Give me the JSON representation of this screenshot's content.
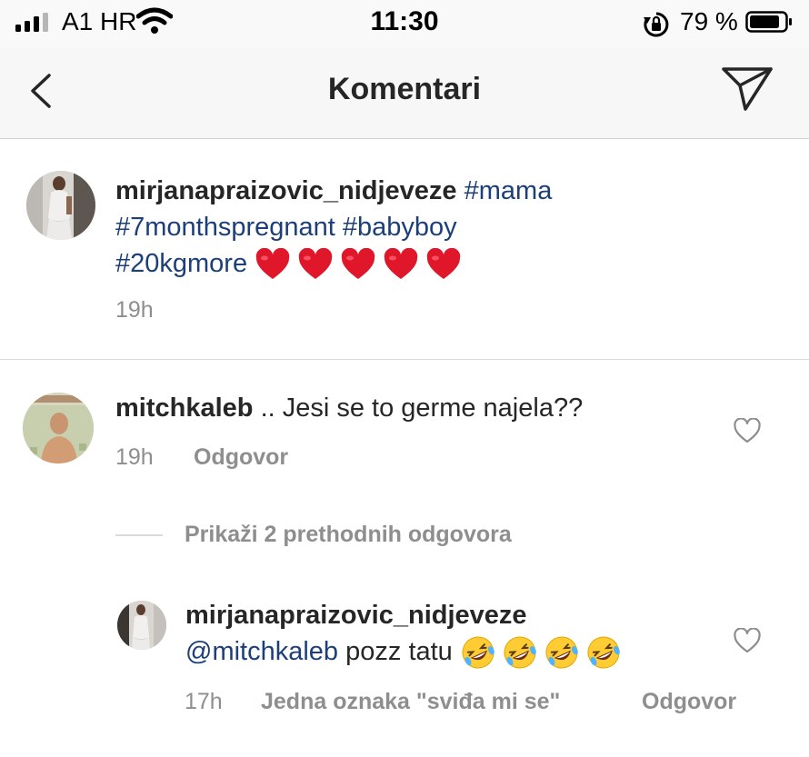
{
  "status_bar": {
    "carrier": "A1 HR",
    "time": "11:30",
    "battery_percent": "79 %",
    "signal_bars_filled": 3
  },
  "header": {
    "title": "Komentari",
    "back_icon": "chevron-left-icon",
    "send_icon": "paper-plane-icon"
  },
  "caption": {
    "username": "mirjanapraizovic_nidjeveze",
    "hashtags": [
      "#mama",
      "#7monthspregnant",
      "#babyboy",
      "#20kgmore"
    ],
    "emoji": "red-heart-emoji",
    "emoji_count": 5,
    "time": "19h"
  },
  "comment": {
    "username": "mitchkaleb",
    "text": ".. Jesi se to germe najela??",
    "time": "19h",
    "reply_label": "Odgovor"
  },
  "view_replies": {
    "label": "Prikaži 2 prethodnih odgovora"
  },
  "reply": {
    "username": "mirjanapraizovic_nidjeveze",
    "mention": "@mitchkaleb",
    "text": "pozz tatu",
    "emoji": "rolling-on-floor-laughing-emoji",
    "emoji_count": 4,
    "time": "17h",
    "likes_label": "Jedna oznaka \"sviđa mi se\"",
    "reply_label": "Odgovor"
  },
  "colors": {
    "hashtag": "#1c3f7a",
    "meta": "#8e8e8e",
    "text": "#262626"
  }
}
